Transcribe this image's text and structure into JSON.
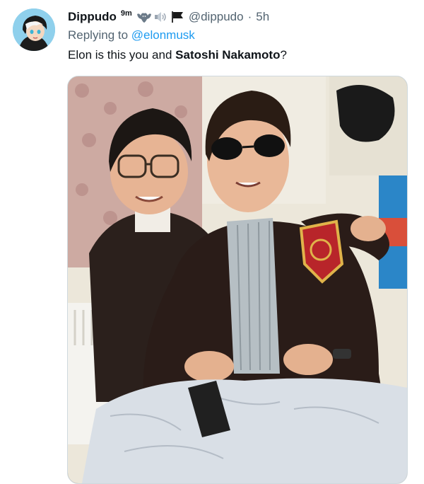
{
  "tweet": {
    "author": {
      "display_name": "Dippudo",
      "name_suffix": "9m",
      "handle": "@dippudo",
      "separator": "·",
      "time": "5h",
      "emoji_icons": [
        "bat-icon",
        "speaker-icon",
        "black-flag-icon"
      ]
    },
    "reply": {
      "prefix": "Replying to ",
      "mention": "@elonmusk"
    },
    "text": {
      "part1": "Elon is this you and ",
      "bold": "Satoshi Nakamoto",
      "part2": "?"
    },
    "media": {
      "description_icon": "photo",
      "colors": {
        "jacket": "#2a1c18",
        "skin": "#e8b593",
        "background_wall": "#e9e4d6",
        "curtain": "#c9a7a0",
        "jeans": "#d8dee6",
        "patch": "#b8252a"
      }
    },
    "colors": {
      "link": "#1d9bf0",
      "secondary_text": "#536471",
      "primary_text": "#0f1419"
    }
  }
}
